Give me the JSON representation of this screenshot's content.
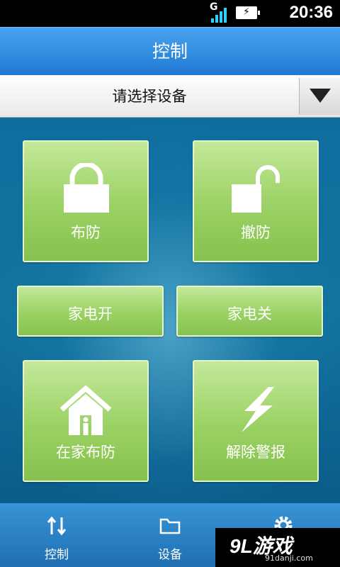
{
  "status_bar": {
    "network": "G",
    "time": "20:36"
  },
  "title": "控制",
  "device_select": {
    "value": "请选择设备"
  },
  "buttons": {
    "arm": "布防",
    "disarm": "撤防",
    "appliance_on": "家电开",
    "appliance_off": "家电关",
    "home_arm": "在家布防",
    "alarm_clear": "解除警报"
  },
  "bottom_nav": [
    {
      "label": "控制",
      "icon": "updown-arrows-icon"
    },
    {
      "label": "设备",
      "icon": "folder-icon"
    },
    {
      "label": "",
      "icon": "gear-icon"
    }
  ],
  "watermark": {
    "logo": "9L游戏",
    "url": "91danji.com"
  },
  "colors": {
    "title_bar": "#2f8ae0",
    "button_green": "#9ad163",
    "background": "#0d5d8a"
  }
}
